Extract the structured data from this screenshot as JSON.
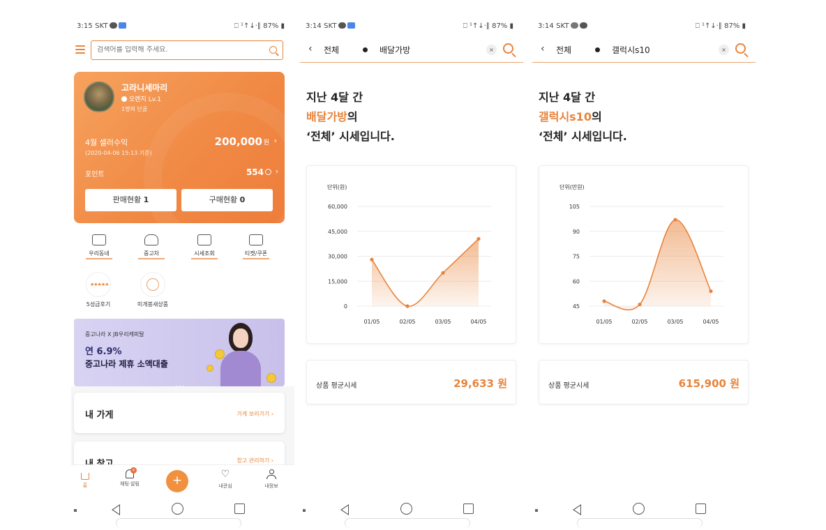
{
  "phone1": {
    "status": {
      "time": "3:15 SKT",
      "right": "⎕ ¹↑↓·∥ 87% ▮"
    },
    "search": {
      "placeholder": "검색어를 입력해 주세요."
    },
    "seller": {
      "nickname": "고라니세마리",
      "level": "오렌지 Lv.1",
      "regulars": "1명의 단골",
      "sales_label": "4월 셀러수익",
      "sales_date": "(2020-04-06 15:13 기준)",
      "sales_amount": "200,000",
      "sales_unit": "원",
      "point_label": "포인트",
      "point_value": "554",
      "btn_sales_label": "판매현황",
      "btn_sales_count": "1",
      "btn_purchase_label": "구매현황",
      "btn_purchase_count": "0"
    },
    "menu": [
      {
        "label": "우리동네",
        "icon": "map-icon"
      },
      {
        "label": "중고차",
        "icon": "car-icon"
      },
      {
        "label": "시세조회",
        "icon": "chart-icon"
      },
      {
        "label": "티켓/쿠폰",
        "icon": "ticket-icon"
      }
    ],
    "circles": [
      {
        "label": "5성급후기",
        "inner": "★★★★★"
      },
      {
        "label": "미개봉새상품",
        "inner": ""
      }
    ],
    "banner": {
      "sub": "중고나라 X JB우리캐피탈",
      "rate": "연 6.9%",
      "title": "중고나라 제휴 소액대출"
    },
    "sections": [
      {
        "title": "내 가게",
        "link": "가게 보러가기"
      },
      {
        "title": "내 창고",
        "link": "창고 관리하기"
      }
    ],
    "nav": [
      {
        "label": "홈"
      },
      {
        "label": "채팅·알림"
      },
      {
        "label": "+"
      },
      {
        "label": "내관심"
      },
      {
        "label": "내정보"
      }
    ]
  },
  "phone2": {
    "status": {
      "time": "3:14 SKT",
      "right": "⎕ ¹↑↓·∥ 87% ▮"
    },
    "header": {
      "category": "전체",
      "keyword": "배달가방"
    },
    "headline": {
      "line1": "지난 4달 간",
      "keyword": "배달가방",
      "suffix": "의",
      "line3": "‘전체’ 시세입니다."
    },
    "avg": {
      "label": "상품 평균시세",
      "value": "29,633 원"
    }
  },
  "phone3": {
    "status": {
      "time": "3:14 SKT",
      "right": "⎕ ¹↑↓·∥ 87% ▮"
    },
    "header": {
      "category": "전체",
      "keyword": "갤럭시s10"
    },
    "headline": {
      "line1": "지난 4달 간",
      "keyword": "갤럭시s10",
      "suffix": "의",
      "line3": "‘전체’ 시세입니다."
    },
    "avg": {
      "label": "상품 평균시세",
      "value": "615,900 원"
    }
  },
  "chart_data": [
    {
      "type": "area",
      "ylabel": "단위(원)",
      "categories": [
        "01/05",
        "02/05",
        "03/05",
        "04/05"
      ],
      "values": [
        28000,
        0,
        20000,
        40500
      ],
      "yticks": [
        "60,000",
        "45,000",
        "30,000",
        "15,000",
        "0"
      ],
      "ylim": [
        0,
        60000
      ],
      "grid": true,
      "color": "#e8833a"
    },
    {
      "type": "area",
      "ylabel": "단위(만원)",
      "categories": [
        "01/05",
        "02/05",
        "03/05",
        "04/05"
      ],
      "values": [
        48,
        46,
        97,
        54
      ],
      "yticks": [
        "105",
        "90",
        "75",
        "60",
        "45"
      ],
      "ylim": [
        45,
        105
      ],
      "grid": true,
      "color": "#e8833a"
    }
  ]
}
